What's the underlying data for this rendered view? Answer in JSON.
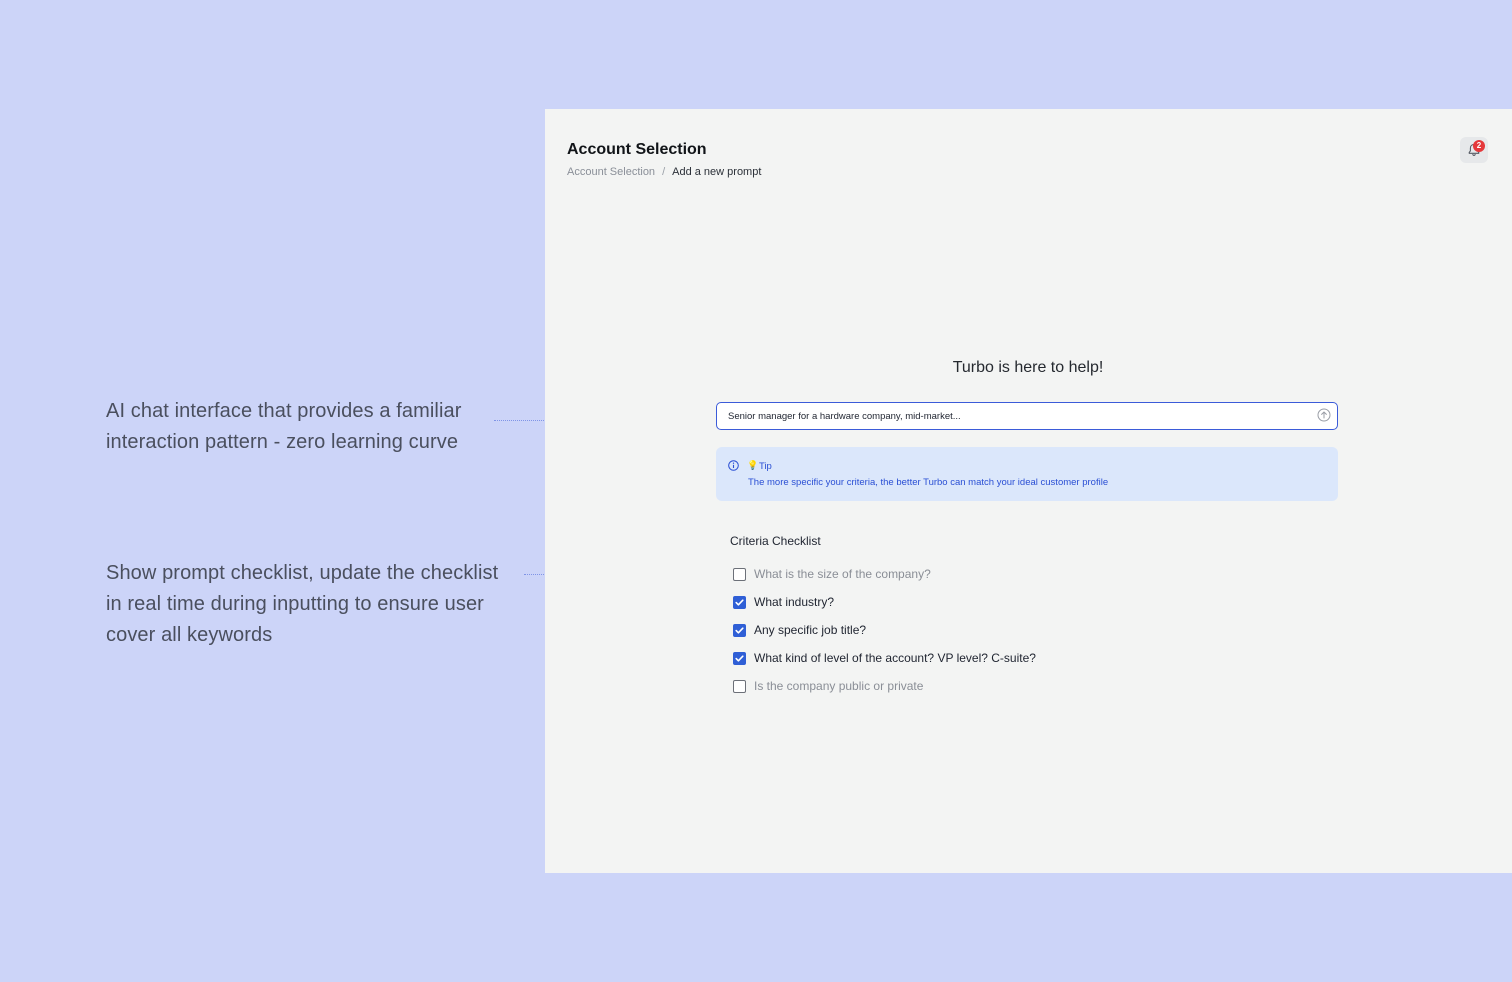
{
  "annotations": [
    {
      "lines": [
        "AI chat interface that provides a familiar",
        "interaction pattern - zero learning curve"
      ]
    },
    {
      "lines": [
        "Show prompt checklist, update the checklist",
        "in real time during inputting to ensure user",
        "cover all keywords"
      ]
    }
  ],
  "header": {
    "title": "Account Selection",
    "breadcrumb": {
      "parent": "Account Selection",
      "separator": "/",
      "current": "Add a new prompt"
    },
    "notifications_count": "2"
  },
  "main": {
    "hero": "Turbo is here to help!",
    "prompt": {
      "value": "Senior manager for a hardware company, mid-market..."
    },
    "tip": {
      "title": "Tip",
      "body": "The more specific your criteria, the better Turbo can match your ideal customer profile"
    },
    "checklist": {
      "title": "Criteria Checklist",
      "items": [
        {
          "label": "What is the size of the company?",
          "checked": false
        },
        {
          "label": "What industry?",
          "checked": true
        },
        {
          "label": "Any specific job title?",
          "checked": true
        },
        {
          "label": "What kind of level of the account? VP level? C-suite?",
          "checked": true
        },
        {
          "label": "Is the company public or private",
          "checked": false
        }
      ]
    }
  },
  "colors": {
    "background": "#ccd4f8",
    "panel": "#f3f4f3",
    "accent": "#2f5fd6",
    "tip_background": "#dbe7fb",
    "badge": "#e5383b"
  },
  "icons": [
    "bell-icon",
    "send-arrow-icon",
    "info-icon",
    "lightbulb-icon",
    "checkmark-icon"
  ]
}
